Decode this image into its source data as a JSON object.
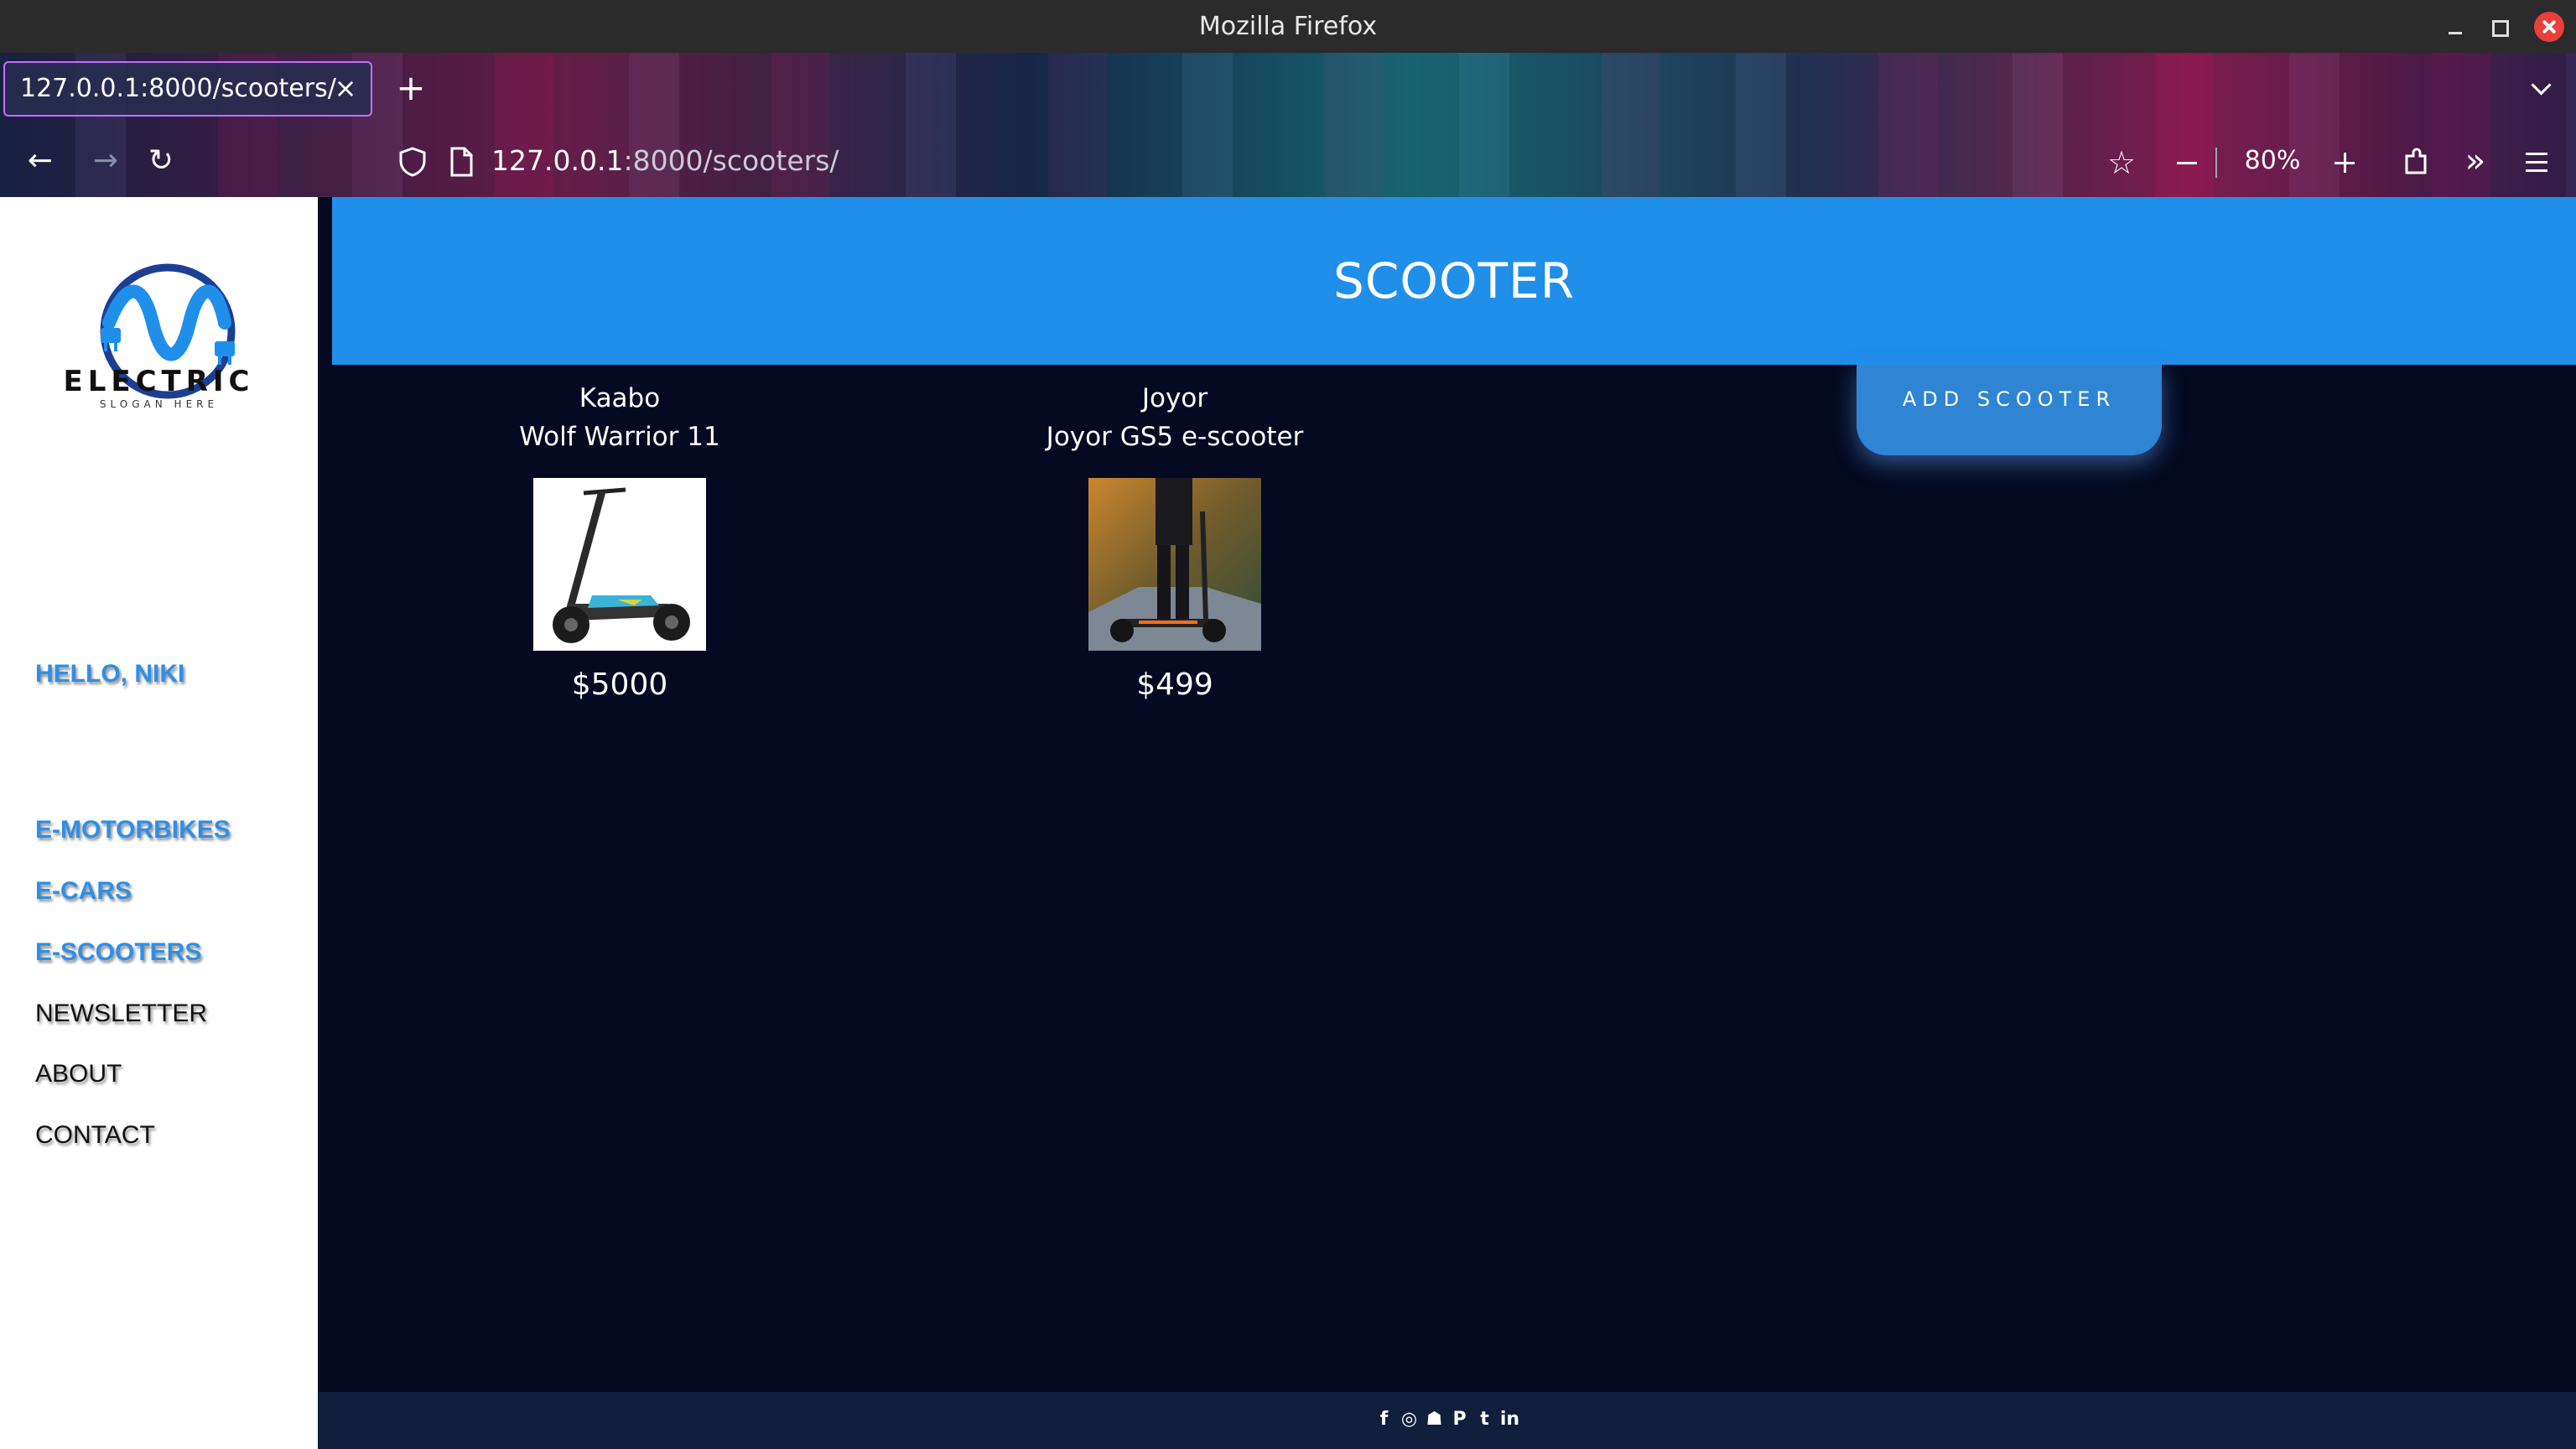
{
  "browser": {
    "window_title": "Mozilla Firefox",
    "tab_title": "127.0.0.1:8000/scooters/",
    "url_host": "127.0.0.1",
    "url_path": ":8000/scooters/",
    "zoom": "80%"
  },
  "sidebar": {
    "logo_word": "ELECTRIC",
    "logo_slogan": "SLOGAN HERE",
    "greeting": "HELLO, NIKI",
    "links": [
      "E-MOTORBIKES",
      "E-CARS",
      "E-SCOOTERS",
      "NEWSLETTER",
      "ABOUT",
      "CONTACT"
    ]
  },
  "main": {
    "banner_title": "SCOOTER",
    "add_button": "ADD SCOOTER",
    "products": [
      {
        "brand": "Kaabo",
        "model": "Wolf Warrior 11",
        "price": "$5000"
      },
      {
        "brand": "Joyor",
        "model": "Joyor GS5 e-scooter",
        "price": "$499"
      }
    ]
  },
  "footer": {
    "social_icons": [
      "facebook-icon",
      "instagram-icon",
      "snapchat-icon",
      "pinterest-icon",
      "twitter-icon",
      "linkedin-icon"
    ]
  },
  "colors": {
    "page_bg": "#050a22",
    "banner": "#1f8fea",
    "accent_link": "#2f8fe6",
    "footer": "#0f1f3c"
  }
}
